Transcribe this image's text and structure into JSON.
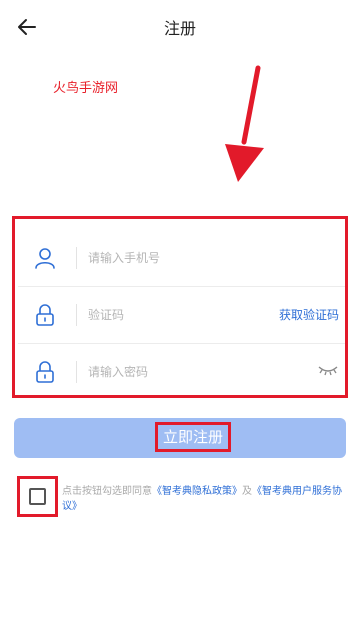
{
  "header": {
    "title": "注册",
    "back_icon": "arrow-left-icon"
  },
  "watermark": "火鸟手游网",
  "form": {
    "phone_placeholder": "请输入手机号",
    "code_placeholder": "验证码",
    "get_code_label": "获取验证码",
    "password_placeholder": "请输入密码",
    "user_icon": "user-icon",
    "lock_icon": "lock-icon",
    "eye_icon": "eye-closed-icon"
  },
  "submit_label": "立即注册",
  "agreement": {
    "prefix": "点击按钮勾选即同意",
    "privacy_link": "《智考典隐私政策》",
    "and": "及",
    "terms_link": "《智考典用户服务协议》"
  },
  "colors": {
    "accent": "#2f6fd6",
    "button": "#9fbdf3",
    "highlight": "#e21a2a"
  }
}
